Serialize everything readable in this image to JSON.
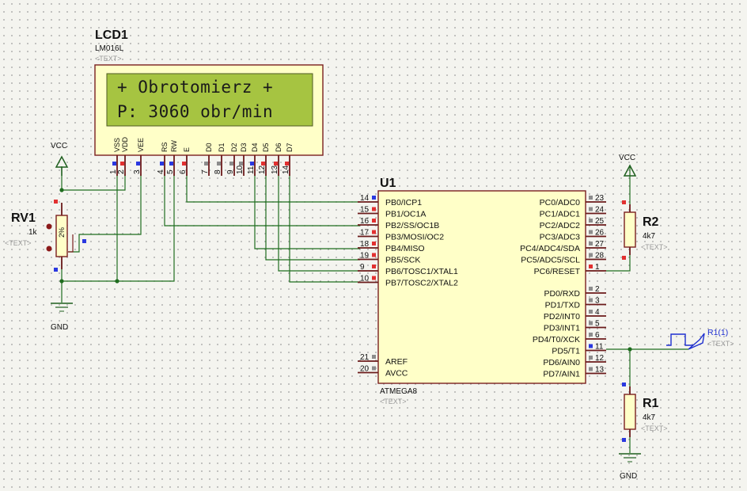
{
  "colors": {
    "background": "#f4f4ef",
    "grid_dot": "#9d9d9d",
    "component_outline": "#7a1f1f",
    "component_fill": "#ffffc8",
    "lcd_screen": "#a6c441",
    "wire": "#1f6d1f",
    "pin_red": "#e23030",
    "pin_blue": "#2a38e0",
    "pin_gray": "#8c8c8c",
    "generator_blue": "#1e2fd0"
  },
  "lcd": {
    "ref": "LCD1",
    "model": "LM016L",
    "text_placeholder": "<TEXT>",
    "line1": "+ Obrotomierz +",
    "line2": "P: 3060 obr/min",
    "pins": [
      {
        "label": "VSS",
        "num": "1"
      },
      {
        "label": "VDD",
        "num": "2"
      },
      {
        "label": "VEE",
        "num": "3"
      },
      {
        "label": "RS",
        "num": "4"
      },
      {
        "label": "RW",
        "num": "5"
      },
      {
        "label": "E",
        "num": "6"
      },
      {
        "label": "D0",
        "num": "7"
      },
      {
        "label": "D1",
        "num": "8"
      },
      {
        "label": "D2",
        "num": "9"
      },
      {
        "label": "D3",
        "num": "10"
      },
      {
        "label": "D4",
        "num": "11"
      },
      {
        "label": "D5",
        "num": "12"
      },
      {
        "label": "D6",
        "num": "13"
      },
      {
        "label": "D7",
        "num": "14"
      }
    ]
  },
  "mcu": {
    "ref": "U1",
    "model": "ATMEGA8",
    "text_placeholder": "<TEXT>",
    "left_pins": [
      {
        "num": "14",
        "label": "PB0/ICP1"
      },
      {
        "num": "15",
        "label": "PB1/OC1A"
      },
      {
        "num": "16",
        "label": "PB2/SS/OC1B"
      },
      {
        "num": "17",
        "label": "PB3/MOSI/OC2"
      },
      {
        "num": "18",
        "label": "PB4/MISO"
      },
      {
        "num": "19",
        "label": "PB5/SCK"
      },
      {
        "num": "9",
        "label": "PB6/TOSC1/XTAL1"
      },
      {
        "num": "10",
        "label": "PB7/TOSC2/XTAL2"
      }
    ],
    "left_pins_bottom": [
      {
        "num": "21",
        "label": "AREF"
      },
      {
        "num": "20",
        "label": "AVCC"
      }
    ],
    "right_pins": [
      {
        "num": "23",
        "label": "PC0/ADC0"
      },
      {
        "num": "24",
        "label": "PC1/ADC1"
      },
      {
        "num": "25",
        "label": "PC2/ADC2"
      },
      {
        "num": "26",
        "label": "PC3/ADC3"
      },
      {
        "num": "27",
        "label": "PC4/ADC4/SDA"
      },
      {
        "num": "28",
        "label": "PC5/ADC5/SCL"
      },
      {
        "num": "1",
        "label": "PC6/RESET"
      }
    ],
    "right_pins_d": [
      {
        "num": "2",
        "label": "PD0/RXD"
      },
      {
        "num": "3",
        "label": "PD1/TXD"
      },
      {
        "num": "4",
        "label": "PD2/INT0"
      },
      {
        "num": "5",
        "label": "PD3/INT1"
      },
      {
        "num": "6",
        "label": "PD4/T0/XCK"
      },
      {
        "num": "11",
        "label": "PD5/T1"
      },
      {
        "num": "12",
        "label": "PD6/AIN0"
      },
      {
        "num": "13",
        "label": "PD7/AIN1"
      }
    ]
  },
  "rv1": {
    "ref": "RV1",
    "value": "1k",
    "text_placeholder": "<TEXT>",
    "wiper": "2%"
  },
  "r2": {
    "ref": "R2",
    "value": "4k7",
    "text_placeholder": "<TEXT>"
  },
  "r1": {
    "ref": "R1",
    "value": "4k7",
    "text_placeholder": "<TEXT>"
  },
  "generator": {
    "ref": "R1(1)",
    "text_placeholder": "<TEXT>"
  },
  "power": {
    "vcc_left": "VCC",
    "vcc_right": "VCC",
    "gnd_left": "GND",
    "gnd_right": "GND"
  }
}
